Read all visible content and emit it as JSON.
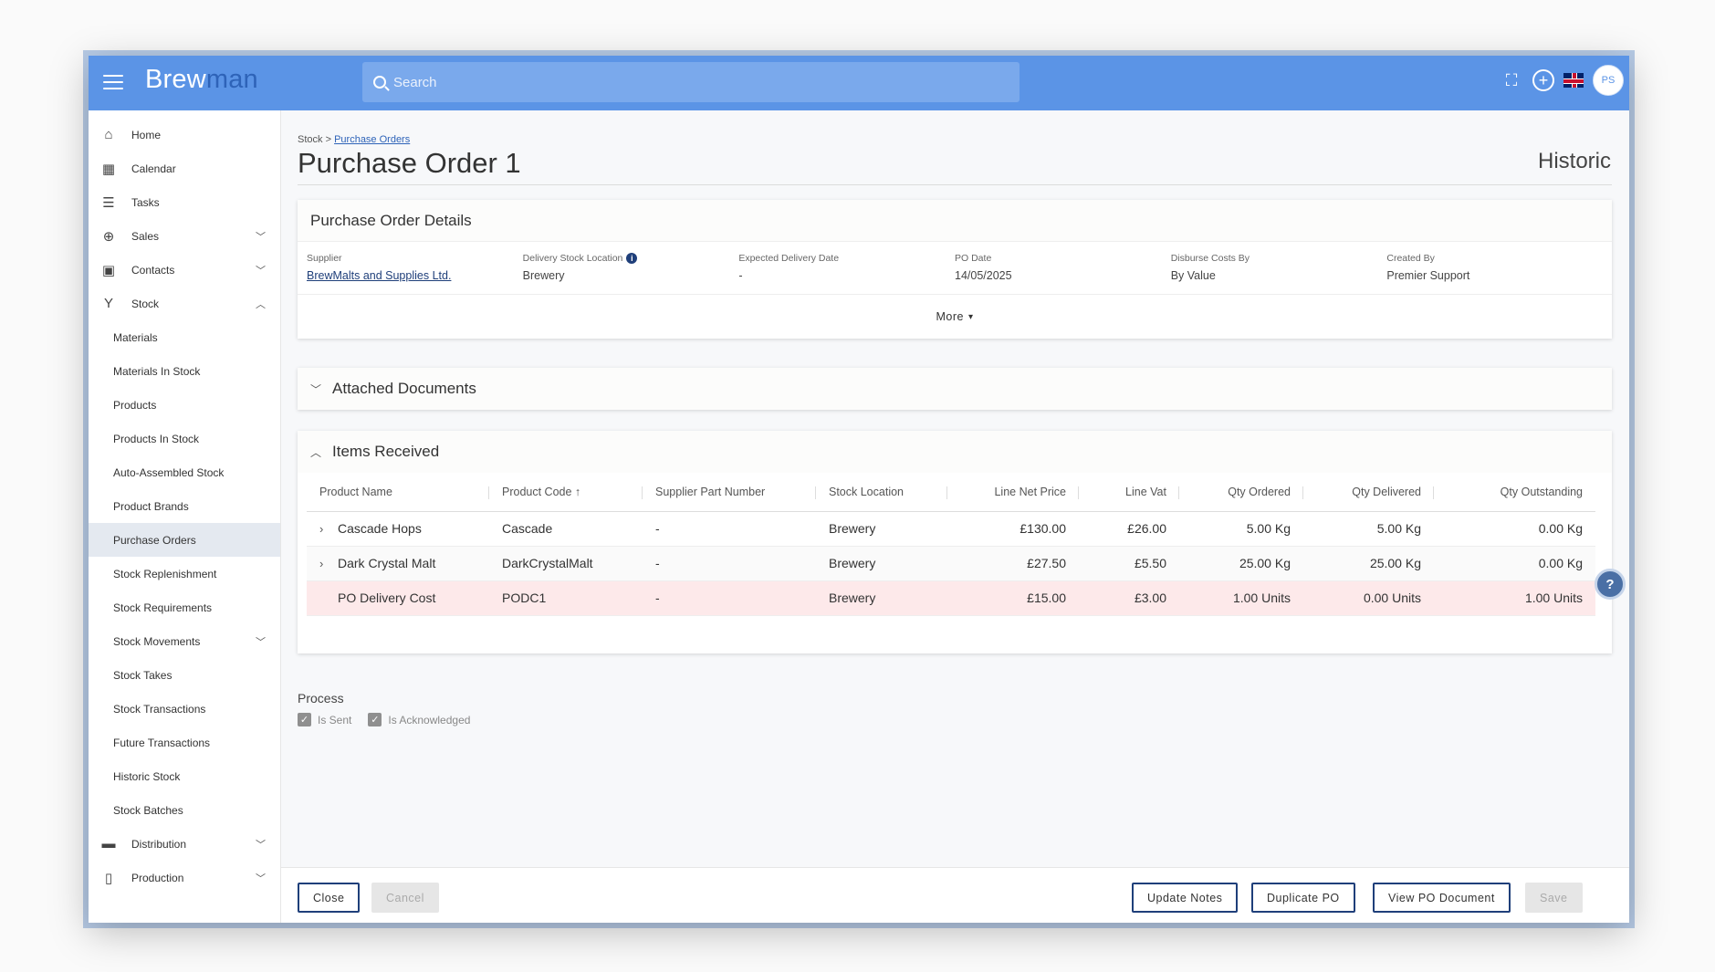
{
  "app": {
    "logo_prefix": "Brew",
    "logo_suffix": "man",
    "user_initials": "PS",
    "brand_color": "#5b94e6"
  },
  "search": {
    "placeholder": "Search"
  },
  "sidebar": {
    "items": [
      {
        "label": "Home",
        "icon": "home-icon"
      },
      {
        "label": "Calendar",
        "icon": "calendar-icon"
      },
      {
        "label": "Tasks",
        "icon": "list-icon"
      },
      {
        "label": "Sales",
        "icon": "basket-icon",
        "expanded": false
      },
      {
        "label": "Contacts",
        "icon": "contacts-icon",
        "expanded": false
      },
      {
        "label": "Stock",
        "icon": "cocktail-icon",
        "expanded": true
      }
    ],
    "stock_sub": [
      "Materials",
      "Materials In Stock",
      "Products",
      "Products In Stock",
      "Auto-Assembled Stock",
      "Product Brands",
      "Purchase Orders",
      "Stock Replenishment",
      "Stock Requirements",
      "Stock Movements",
      "Stock Takes",
      "Stock Transactions",
      "Future Transactions",
      "Historic Stock",
      "Stock Batches"
    ],
    "bottom_items": [
      {
        "label": "Distribution",
        "icon": "truck-icon"
      },
      {
        "label": "Production",
        "icon": "cup-icon"
      }
    ],
    "active": "Purchase Orders"
  },
  "breadcrumb": {
    "root": "Stock",
    "sep": ">",
    "current": "Purchase Orders"
  },
  "page": {
    "title": "Purchase Order 1",
    "status": "Historic"
  },
  "details": {
    "header": "Purchase Order Details",
    "supplier_label": "Supplier",
    "supplier_value": "BrewMalts and Supplies Ltd.",
    "location_label": "Delivery Stock Location",
    "location_value": "Brewery",
    "expected_label": "Expected Delivery Date",
    "expected_value": "-",
    "podate_label": "PO Date",
    "podate_value": "14/05/2025",
    "disburse_label": "Disburse Costs By",
    "disburse_value": "By Value",
    "created_label": "Created By",
    "created_value": "Premier Support",
    "more_label": "More"
  },
  "attached": {
    "header": "Attached Documents"
  },
  "items": {
    "header": "Items Received",
    "columns": {
      "name": "Product Name",
      "code": "Product Code",
      "part": "Supplier Part Number",
      "location": "Stock Location",
      "net": "Line Net Price",
      "vat": "Line Vat",
      "ordered": "Qty Ordered",
      "delivered": "Qty Delivered",
      "outstanding": "Qty Outstanding"
    },
    "rows": [
      {
        "name": "Cascade Hops",
        "code": "Cascade",
        "part": "-",
        "location": "Brewery",
        "net": "£130.00",
        "vat": "£26.00",
        "ordered": "5.00 Kg",
        "delivered": "5.00 Kg",
        "outstanding": "0.00 Kg"
      },
      {
        "name": "Dark Crystal Malt",
        "code": "DarkCrystalMalt",
        "part": "-",
        "location": "Brewery",
        "net": "£27.50",
        "vat": "£5.50",
        "ordered": "25.00 Kg",
        "delivered": "25.00 Kg",
        "outstanding": "0.00 Kg"
      },
      {
        "name": "PO Delivery Cost",
        "code": "PODC1",
        "part": "-",
        "location": "Brewery",
        "net": "£15.00",
        "vat": "£3.00",
        "ordered": "1.00 Units",
        "delivered": "0.00 Units",
        "outstanding": "1.00 Units"
      }
    ]
  },
  "process": {
    "label": "Process",
    "is_sent": "Is Sent",
    "is_acknowledged": "Is Acknowledged"
  },
  "footer": {
    "close": "Close",
    "cancel": "Cancel",
    "update_notes": "Update Notes",
    "duplicate": "Duplicate PO",
    "view_doc": "View PO Document",
    "save": "Save"
  }
}
